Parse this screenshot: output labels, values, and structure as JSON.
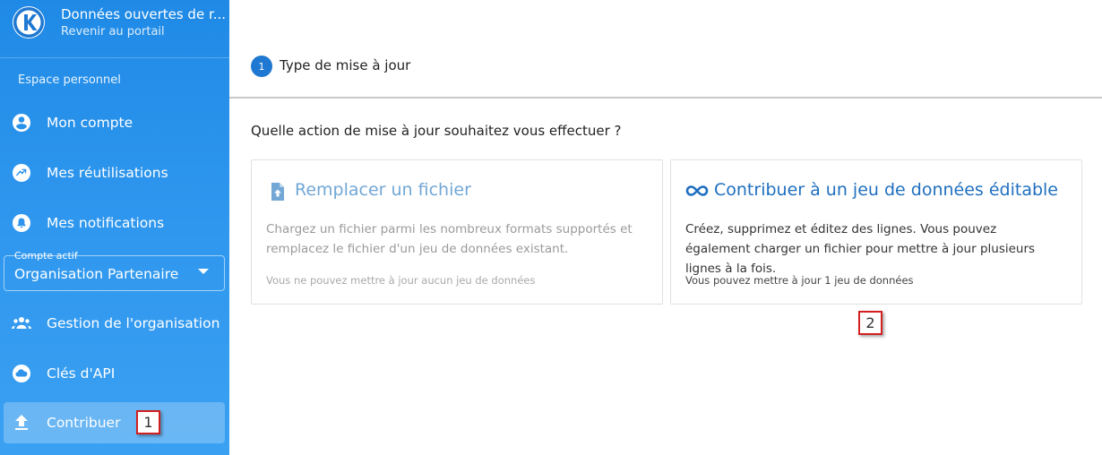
{
  "brand": {
    "title": "Données ouvertes de r...",
    "subtitle": "Revenir au portail",
    "logo_icon": "k-logo-icon"
  },
  "sidebar": {
    "section_label": "Espace personnel",
    "items": [
      {
        "label": "Mon compte",
        "icon": "account-circle-icon"
      },
      {
        "label": "Mes réutilisations",
        "icon": "share-arrow-icon"
      },
      {
        "label": "Mes notifications",
        "icon": "bell-icon"
      }
    ],
    "account_select": {
      "legend": "Compte actif",
      "value": "Organisation Partenaire"
    },
    "org_items": [
      {
        "label": "Gestion de l'organisation",
        "icon": "group-icon"
      },
      {
        "label": "Clés d'API",
        "icon": "cloud-icon"
      },
      {
        "label": "Contribuer",
        "icon": "upload-icon",
        "active": true
      }
    ]
  },
  "stepper": {
    "step_number": "1",
    "step_label": "Type de mise à jour"
  },
  "main": {
    "question": "Quelle action de mise à jour souhaitez vous effectuer ?",
    "cards": [
      {
        "title": "Remplacer un fichier",
        "icon": "file-upload-icon",
        "description": "Chargez un fichier parmi les nombreux formats supportés et remplacez le fichier d'un jeu de données existant.",
        "footer": "Vous ne pouvez mettre à jour aucun jeu de données",
        "enabled": false
      },
      {
        "title": "Contribuer à un jeu de données éditable",
        "icon": "infinity-icon",
        "description": "Créez, supprimez et éditez des lignes. Vous pouvez également charger un fichier pour mettre à jour plusieurs lignes à la fois.",
        "footer": "Vous pouvez mettre à jour 1 jeu de données",
        "enabled": true
      }
    ]
  },
  "annotations": {
    "marker_1": "1",
    "marker_2": "2"
  },
  "colors": {
    "sidebar_top": "#1f8ae6",
    "sidebar_bottom": "#3aa0f2",
    "primary": "#1f6fbf",
    "marker_border": "#d21f1f"
  }
}
